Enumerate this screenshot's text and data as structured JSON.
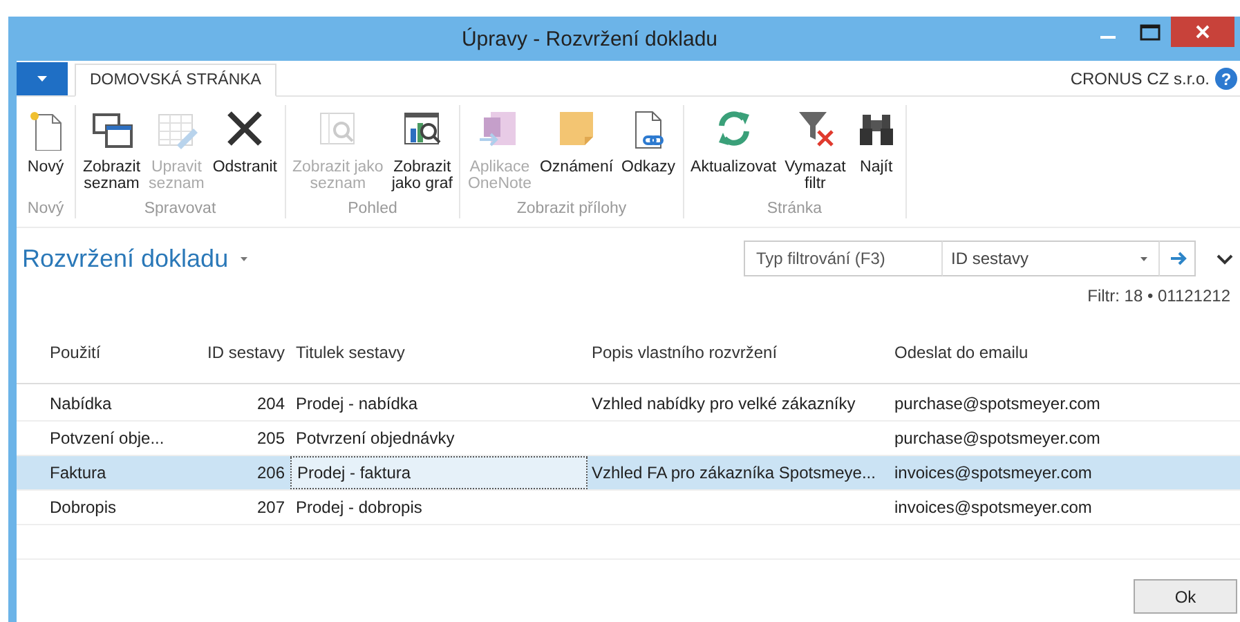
{
  "window": {
    "title": "Úpravy - Rozvržení dokladu"
  },
  "ribbon": {
    "tabs": [
      {
        "label": "DOMOVSKÁ STRÁNKA",
        "selected": true
      }
    ],
    "company": "CRONUS CZ s.r.o.",
    "help": "?",
    "groups": [
      {
        "label": "Nový",
        "buttons": [
          {
            "label": [
              "Nový"
            ],
            "disabled": false
          }
        ]
      },
      {
        "label": "Spravovat",
        "buttons": [
          {
            "label": [
              "Zobrazit",
              "seznam"
            ],
            "disabled": false
          },
          {
            "label": [
              "Upravit",
              "seznam"
            ],
            "disabled": true
          },
          {
            "label": [
              "Odstranit"
            ],
            "disabled": false
          }
        ]
      },
      {
        "label": "Pohled",
        "buttons": [
          {
            "label": [
              "Zobrazit jako",
              "seznam"
            ],
            "disabled": true
          },
          {
            "label": [
              "Zobrazit",
              "jako graf"
            ],
            "disabled": false
          }
        ]
      },
      {
        "label": "Zobrazit přílohy",
        "buttons": [
          {
            "label": [
              "Aplikace",
              "OneNote"
            ],
            "disabled": true
          },
          {
            "label": [
              "Oznámení"
            ],
            "disabled": false
          },
          {
            "label": [
              "Odkazy"
            ],
            "disabled": false
          }
        ]
      },
      {
        "label": "Stránka",
        "buttons": [
          {
            "label": [
              "Aktualizovat"
            ],
            "disabled": false
          },
          {
            "label": [
              "Vymazat",
              "filtr"
            ],
            "disabled": false
          },
          {
            "label": [
              "Najít"
            ],
            "disabled": false
          }
        ]
      }
    ]
  },
  "page": {
    "title": "Rozvržení dokladu",
    "filter": {
      "placeholder": "Typ filtrování (F3)",
      "field": "ID sestavy"
    },
    "filter_summary": "Filtr: 18 • 01121212"
  },
  "table": {
    "columns": [
      "Použití",
      "ID sestavy",
      "Titulek sestavy",
      "Popis vlastního rozvržení",
      "Odeslat do emailu"
    ],
    "rows": [
      {
        "cells": [
          "Nabídka",
          "204",
          "Prodej - nabídka",
          "Vzhled nabídky pro velké zákazníky",
          "purchase@spotsmeyer.com"
        ],
        "selected": false
      },
      {
        "cells": [
          "Potvzení obje...",
          "205",
          "Potvrzení objednávky",
          "",
          "purchase@spotsmeyer.com"
        ],
        "selected": false
      },
      {
        "cells": [
          "Faktura",
          "206",
          "Prodej - faktura",
          "Vzhled FA pro zákazníka Spotsmeye...",
          "invoices@spotsmeyer.com"
        ],
        "selected": true
      },
      {
        "cells": [
          "Dobropis",
          "207",
          "Prodej - dobropis",
          "",
          "invoices@spotsmeyer.com"
        ],
        "selected": false
      }
    ]
  },
  "buttons": [
    "Ok"
  ]
}
